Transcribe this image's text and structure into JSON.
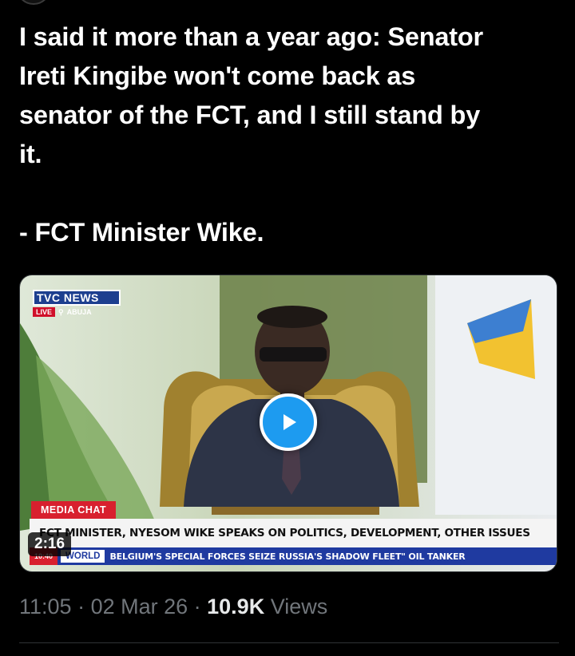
{
  "tweet": {
    "text": "I said it more than a year ago: Senator\nIreti Kingibe won't come back as\nsenator of the FCT, and I still stand by\nit.",
    "signature": "- FCT Minister Wike."
  },
  "video": {
    "channel": "TVC NEWS",
    "live_label": "LIVE",
    "location": "ABUJA",
    "segment_label": "MEDIA CHAT",
    "headline": "FCT MINISTER, NYESOM WIKE SPEAKS ON POLITICS, DEVELOPMENT, OTHER ISSUES",
    "ticker_time": "10:40",
    "ticker_category": "WORLD",
    "ticker_text": "BELGIUM'S SPECIAL FORCES SEIZE RUSSIA'S SHADOW FLEET\" OIL TANKER",
    "duration": "2:16",
    "play_icon": "play-icon",
    "accent": "#1d9bf0"
  },
  "meta": {
    "time": "11:05",
    "separator": " · ",
    "date": "02 Mar 26",
    "views_count": "10.9K",
    "views_label": " Views"
  },
  "colors": {
    "background": "#000000",
    "text": "#ffffff",
    "muted": "#71767b"
  }
}
